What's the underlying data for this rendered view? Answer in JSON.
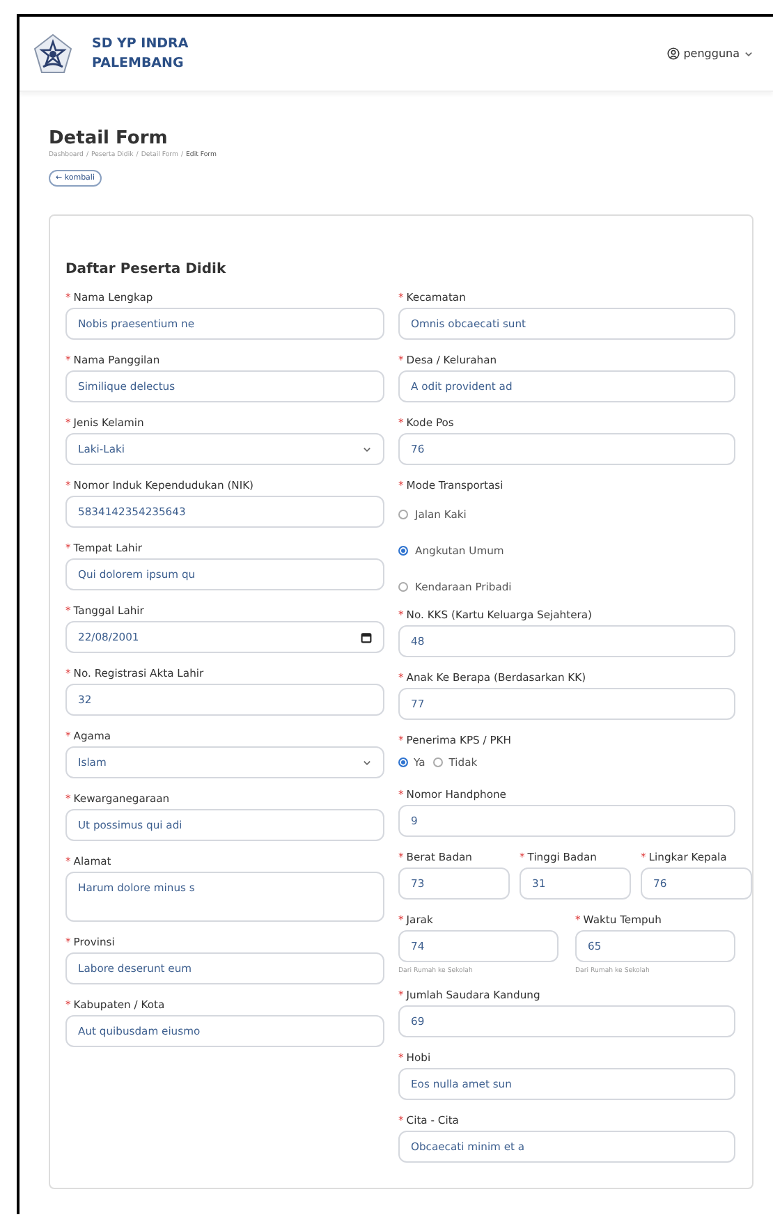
{
  "header": {
    "school_name": [
      "SD YP INDRA",
      "PALEMBANG"
    ],
    "user": "pengguna"
  },
  "page": {
    "title": "Detail Form",
    "breadcrumb": [
      "Dashboard",
      "Peserta Didik",
      "Detail Form",
      "Edit Form"
    ],
    "separator": "/",
    "back_button": "← kombali"
  },
  "form": {
    "title": "Daftar Peserta Didik",
    "left_fields": [
      {
        "kind": "text",
        "mark": "*",
        "label": "Nama Lengkap",
        "value": "Nobis praesentium ne"
      },
      {
        "kind": "text",
        "mark": "*",
        "label": "Nama Panggilan",
        "value": "Similique delectus"
      },
      {
        "kind": "select",
        "mark": "*",
        "label": "Jenis Kelamin",
        "value": "Laki-Laki"
      },
      {
        "kind": "text",
        "mark": "*",
        "label": "Nomor Induk Kependudukan (NIK)",
        "value": "5834142354235643"
      },
      {
        "kind": "text",
        "mark": "*",
        "label": "Tempat Lahir",
        "value": "Qui dolorem ipsum qu"
      },
      {
        "kind": "date",
        "mark": "*",
        "label": "Tanggal Lahir",
        "value": "22/08/2001"
      },
      {
        "kind": "text",
        "mark": "*",
        "label": "No. Registrasi Akta Lahir",
        "value": "32"
      },
      {
        "kind": "select",
        "mark": "*",
        "label": "Agama",
        "value": "Islam"
      },
      {
        "kind": "text",
        "mark": "*",
        "label": "Kewarganegaraan",
        "value": "Ut possimus qui adi"
      },
      {
        "kind": "textarea",
        "mark": "*",
        "label": "Alamat",
        "value": "Harum dolore minus s"
      },
      {
        "kind": "text",
        "mark": "*",
        "label": "Provinsi",
        "value": "Labore deserunt eum"
      },
      {
        "kind": "text",
        "mark": "*",
        "label": "Kabupaten / Kota",
        "value": "Aut quibusdam eiusmo"
      }
    ],
    "right_fields": [
      {
        "kind": "text",
        "mark": "*",
        "label": "Kecamatan",
        "value": "Omnis obcaecati sunt"
      },
      {
        "kind": "text",
        "mark": "*",
        "label": "Desa / Kelurahan",
        "value": "A odit provident ad"
      },
      {
        "kind": "text",
        "mark": "*",
        "label": "Kode Pos",
        "value": "76"
      },
      {
        "kind": "radio_stack",
        "mark": "*",
        "label": "Mode Transportasi",
        "options": [
          {
            "label": "Jalan Kaki",
            "selected": false
          },
          {
            "label": "Angkutan Umum",
            "selected": true
          },
          {
            "label": "Kendaraan Pribadi",
            "selected": false
          }
        ]
      },
      {
        "kind": "text",
        "mark": "*",
        "label": "No. KKS (Kartu Keluarga Sejahtera)",
        "value": "48"
      },
      {
        "kind": "text",
        "mark": "*",
        "label": "Anak Ke Berapa (Berdasarkan KK)",
        "value": "77"
      },
      {
        "kind": "radio_inline",
        "mark": "*",
        "label": "Penerima KPS / PKH",
        "options": [
          {
            "label": "Ya",
            "selected": true
          },
          {
            "label": "Tidak",
            "selected": false
          }
        ]
      },
      {
        "kind": "text",
        "mark": "*",
        "label": "Nomor Handphone",
        "value": "9"
      },
      {
        "kind": "row3",
        "fields": [
          {
            "mark": "*",
            "label": "Berat Badan",
            "value": "73"
          },
          {
            "mark": "*",
            "label": "Tinggi Badan",
            "value": "31"
          },
          {
            "mark": "*",
            "label": "Lingkar Kepala",
            "value": "76"
          }
        ]
      },
      {
        "kind": "row2",
        "fields": [
          {
            "mark": "*",
            "label": "Jarak",
            "value": "74",
            "help": "Dari Rumah ke Sekolah"
          },
          {
            "mark": "*",
            "label": "Waktu Tempuh",
            "value": "65",
            "help": "Dari Rumah ke Sekolah"
          }
        ]
      },
      {
        "kind": "text",
        "mark": "*",
        "label": "Jumlah Saudara Kandung",
        "value": "69"
      },
      {
        "kind": "text",
        "mark": "*",
        "label": "Hobi",
        "value": "Eos nulla amet sun"
      },
      {
        "kind": "text",
        "mark": "*",
        "label": "Cita - Cita",
        "value": "Obcaecati minim et a"
      }
    ]
  }
}
